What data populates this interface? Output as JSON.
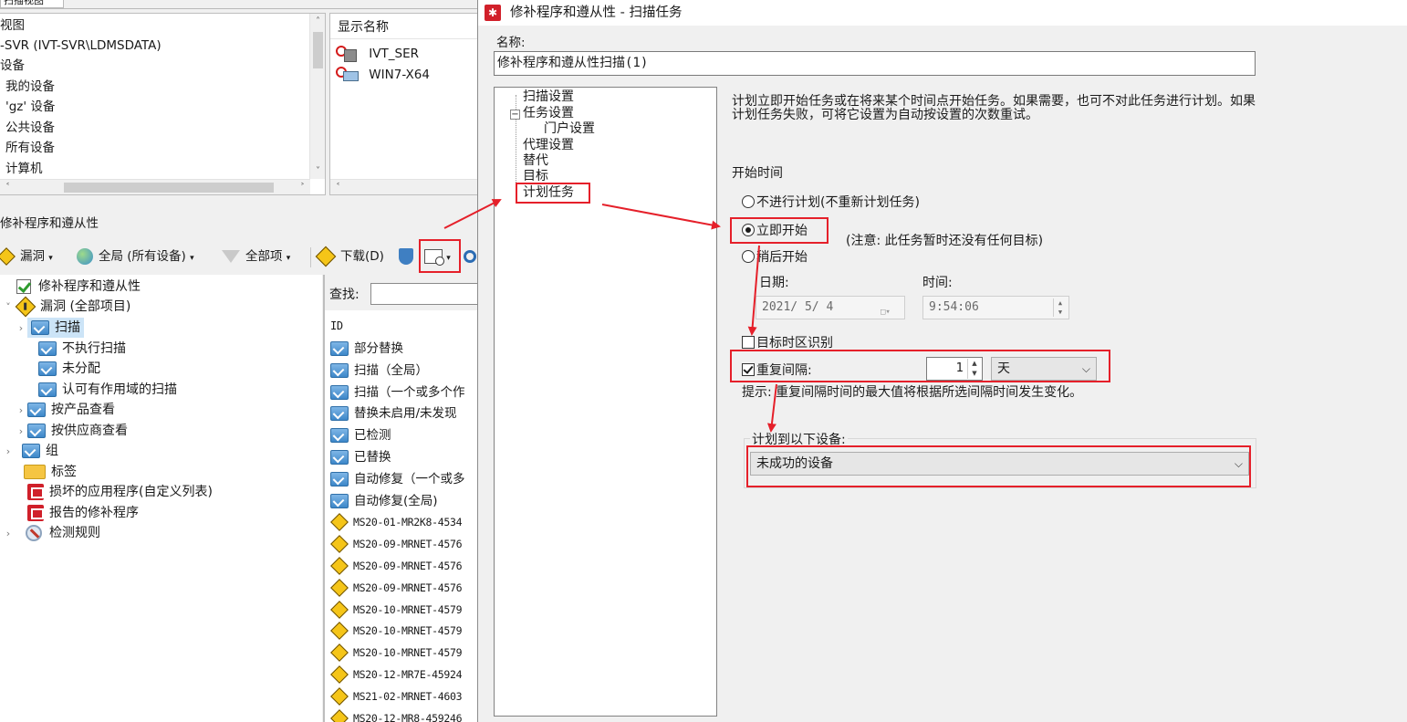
{
  "left": {
    "tab_label": "扫描视图",
    "tree": [
      "视图",
      "-SVR (IVT-SVR\\LDMSDATA)",
      "设备",
      "我的设备",
      "'gz' 设备",
      "公共设备",
      "所有设备",
      "计算机"
    ],
    "display_name_header": "显示名称",
    "devices": [
      "IVT_SER",
      "WIN7-X64"
    ],
    "section_title": "修补程序和遵从性",
    "toolbar": {
      "vuln": "漏洞",
      "scope": "全局 (所有设备)",
      "filter": "全部项",
      "download": "下载(D)"
    },
    "bottom_tree": [
      "修补程序和遵从性",
      "漏洞 (全部项目)",
      "扫描",
      "不执行扫描",
      "未分配",
      "认可有作用域的扫描",
      "按产品查看",
      "按供应商查看",
      "组",
      "标签",
      "损坏的应用程序(自定义列表)",
      "报告的修补程序",
      "检测规则"
    ],
    "search_label": "查找:",
    "id_header": "ID",
    "right_list": [
      "部分替换",
      "扫描（全局）",
      "扫描（一个或多个作",
      "替换未启用/未发现",
      "已检测",
      "已替换",
      "自动修复（一个或多",
      "自动修复(全局)",
      "MS20-01-MR2K8-4534",
      "MS20-09-MRNET-4576",
      "MS20-09-MRNET-4576",
      "MS20-09-MRNET-4576",
      "MS20-10-MRNET-4579",
      "MS20-10-MRNET-4579",
      "MS20-10-MRNET-4579",
      "MS20-12-MR7E-45924",
      "MS21-02-MRNET-4603",
      "MS20-12-MR8-459246"
    ]
  },
  "dialog": {
    "title": "修补程序和遵从性 - 扫描任务",
    "name_label": "名称:",
    "name_value": "修补程序和遵从性扫描(1)",
    "nav": [
      "扫描设置",
      "任务设置",
      "门户设置",
      "代理设置",
      "替代",
      "目标",
      "计划任务"
    ],
    "description": "计划立即开始任务或在将来某个时间点开始任务。如果需要，也可不对此任务进行计划。如果计划任务失败，可将它设置为自动按设置的次数重试。",
    "start_time_label": "开始时间",
    "opt_no_schedule": "不进行计划(不重新计划任务)",
    "opt_now": "立即开始",
    "note": "(注意: 此任务暂时还没有任何目标)",
    "opt_later": "稍后开始",
    "date_label": "日期:",
    "time_label": "时间:",
    "date_value": "2021/ 5/ 4",
    "time_value": "9:54:06",
    "target_tz": "目标时区识别",
    "repeat_label": "重复间隔:",
    "repeat_value": "1",
    "repeat_unit": "天",
    "hint": "提示: 重复间隔时间的最大值将根据所选间隔时间发生变化。",
    "schedule_to_label": "计划到以下设备:",
    "schedule_to_value": "未成功的设备"
  },
  "colors": {
    "annotation": "#e5202a",
    "accent": "#d1202a"
  }
}
